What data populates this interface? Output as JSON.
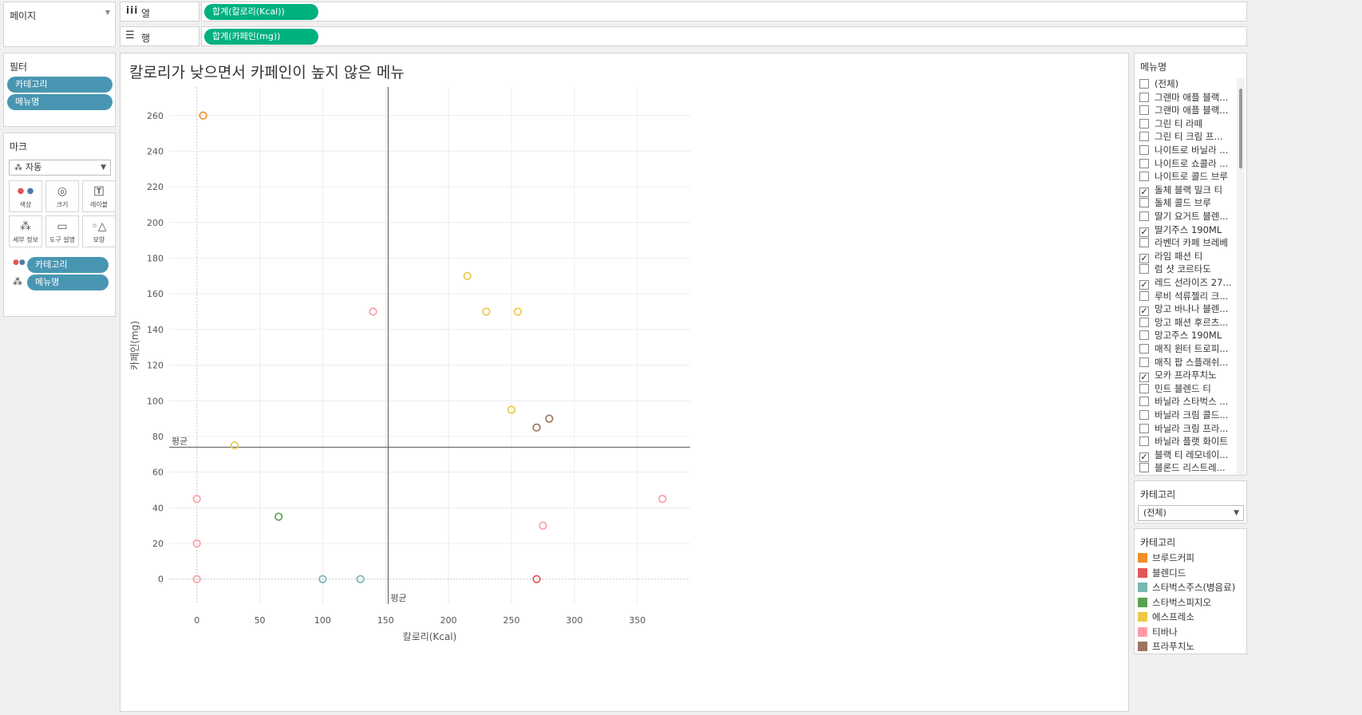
{
  "shelves": {
    "pages_label": "페이지",
    "columns_label": "열",
    "rows_label": "행",
    "columns_pill": "합계(칼로리(Kcal))",
    "rows_pill": "합계(카페인(mg))"
  },
  "filters": {
    "title": "필터",
    "items": [
      "카테고리",
      "메뉴명"
    ]
  },
  "marks": {
    "title": "마크",
    "type": "자동",
    "buttons": [
      "색상",
      "크기",
      "레이블",
      "세부 정보",
      "도구 설명",
      "모양"
    ],
    "fields": [
      "카테고리",
      "메뉴명"
    ]
  },
  "menu_filter": {
    "title": "메뉴명",
    "items": [
      {
        "label": "(전체)",
        "checked": false
      },
      {
        "label": "그랜마 애플 블랙...",
        "checked": false
      },
      {
        "label": "그랜마 애플 블랙...",
        "checked": false
      },
      {
        "label": "그린 티 라떼",
        "checked": false
      },
      {
        "label": "그린 티 크림 프...",
        "checked": false
      },
      {
        "label": "나이트로 바닐라 ...",
        "checked": false
      },
      {
        "label": "나이트로 쇼콜라 ...",
        "checked": false
      },
      {
        "label": "나이트로 콜드 브루",
        "checked": false
      },
      {
        "label": "돌체 블랙 밀크 티",
        "checked": true
      },
      {
        "label": "돌체 콜드 브루",
        "checked": false
      },
      {
        "label": "딸기 요거트 블렌...",
        "checked": false
      },
      {
        "label": "딸기주스 190ML",
        "checked": true
      },
      {
        "label": "라벤더 카페 브레베",
        "checked": false
      },
      {
        "label": "라임 패션 티",
        "checked": true
      },
      {
        "label": "럼 샷 코르타도",
        "checked": false
      },
      {
        "label": "레드 선라이즈 27...",
        "checked": true
      },
      {
        "label": "루비 석류젤리 크...",
        "checked": false
      },
      {
        "label": "망고 바나나 블렌...",
        "checked": true
      },
      {
        "label": "망고 패션 후르츠...",
        "checked": false
      },
      {
        "label": "망고주스 190ML",
        "checked": false
      },
      {
        "label": "매직 윈터 트로피...",
        "checked": false
      },
      {
        "label": "매직 팝 스플래쉬...",
        "checked": false
      },
      {
        "label": "모카 프라푸치노",
        "checked": true
      },
      {
        "label": "민트 블렌드 티",
        "checked": false
      },
      {
        "label": "바닐라 스타벅스 ...",
        "checked": false
      },
      {
        "label": "바닐라 크림 콜드...",
        "checked": false
      },
      {
        "label": "바닐라 크림 프라...",
        "checked": false
      },
      {
        "label": "바닐라 플랫 화이트",
        "checked": false
      },
      {
        "label": "블랙 티 레모네이...",
        "checked": true
      },
      {
        "label": "블론드 리스트레...",
        "checked": false
      }
    ]
  },
  "category_filter": {
    "title": "카테고리",
    "selected": "(전체)"
  },
  "legend": {
    "title": "카테고리",
    "items": [
      {
        "label": "브루드커피",
        "color": "#f28e2b"
      },
      {
        "label": "블렌디드",
        "color": "#e15759"
      },
      {
        "label": "스타벅스주스(병음료)",
        "color": "#76b7b2"
      },
      {
        "label": "스타벅스피지오",
        "color": "#59a14f"
      },
      {
        "label": "에스프레소",
        "color": "#edc948"
      },
      {
        "label": "티바나",
        "color": "#ff9da7"
      },
      {
        "label": "프라푸치노",
        "color": "#9c755f"
      }
    ]
  },
  "chart_data": {
    "type": "scatter",
    "title": "칼로리가 낮으면서 카페인이 높지 않은 메뉴",
    "xlabel": "칼로리(Kcal)",
    "ylabel": "카페인(mg)",
    "xlim": [
      -22,
      392
    ],
    "ylim": [
      -14,
      276
    ],
    "xticks": [
      0,
      50,
      100,
      150,
      200,
      250,
      300,
      350
    ],
    "yticks": [
      0,
      20,
      40,
      60,
      80,
      100,
      120,
      140,
      160,
      180,
      200,
      220,
      240,
      260
    ],
    "reference_lines": [
      {
        "axis": "x",
        "value": 152,
        "label": "평균"
      },
      {
        "axis": "y",
        "value": 74,
        "label": "평균"
      }
    ],
    "points": [
      {
        "x": 5,
        "y": 260,
        "category": "브루드커피"
      },
      {
        "x": 270,
        "y": 0,
        "category": "블렌디드"
      },
      {
        "x": 100,
        "y": 0,
        "category": "스타벅스주스(병음료)"
      },
      {
        "x": 130,
        "y": 0,
        "category": "스타벅스주스(병음료)"
      },
      {
        "x": 65,
        "y": 35,
        "category": "스타벅스피지오"
      },
      {
        "x": 30,
        "y": 75,
        "category": "에스프레소"
      },
      {
        "x": 215,
        "y": 170,
        "category": "에스프레소"
      },
      {
        "x": 230,
        "y": 150,
        "category": "에스프레소"
      },
      {
        "x": 255,
        "y": 150,
        "category": "에스프레소"
      },
      {
        "x": 250,
        "y": 95,
        "category": "에스프레소"
      },
      {
        "x": 140,
        "y": 150,
        "category": "티바나"
      },
      {
        "x": 0,
        "y": 45,
        "category": "티바나"
      },
      {
        "x": 0,
        "y": 20,
        "category": "티바나"
      },
      {
        "x": 0,
        "y": 0,
        "category": "티바나"
      },
      {
        "x": 275,
        "y": 30,
        "category": "티바나"
      },
      {
        "x": 370,
        "y": 45,
        "category": "티바나"
      },
      {
        "x": 270,
        "y": 85,
        "category": "프라푸치노"
      },
      {
        "x": 280,
        "y": 90,
        "category": "프라푸치노"
      }
    ]
  }
}
